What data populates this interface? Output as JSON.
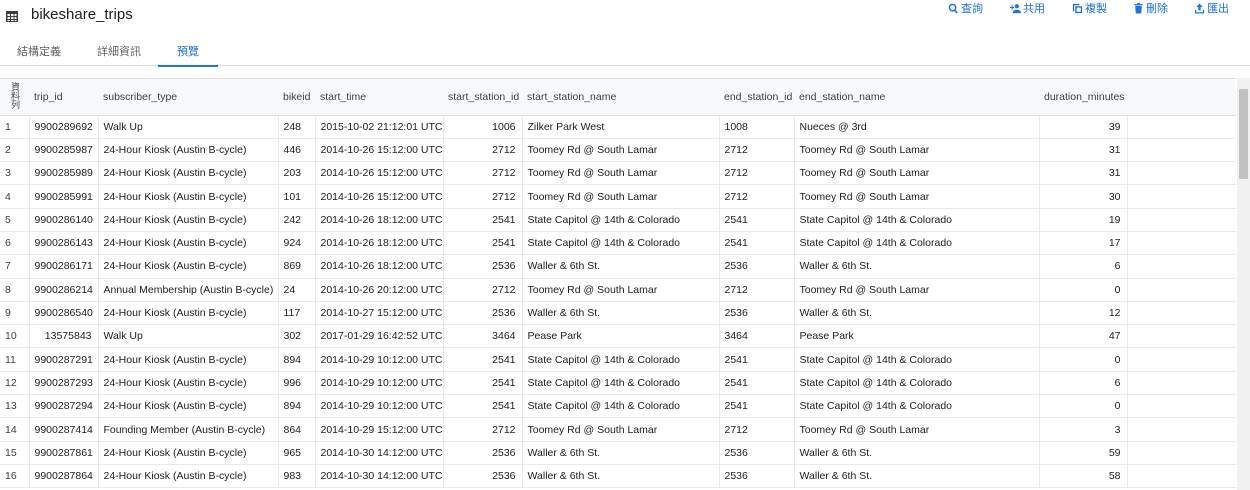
{
  "header": {
    "title": "bikeshare_trips",
    "actions": {
      "query": "查詢",
      "share": "共用",
      "copy": "複製",
      "delete": "刪除",
      "export": "匯出"
    }
  },
  "tabs": {
    "schema": "結構定義",
    "details": "詳細資訊",
    "preview": "預覽"
  },
  "table": {
    "row_header_label": "資料列",
    "columns": {
      "trip_id": "trip_id",
      "subscriber_type": "subscriber_type",
      "bikeid": "bikeid",
      "start_time": "start_time",
      "start_station_id": "start_station_id",
      "start_station_name": "start_station_name",
      "end_station_id": "end_station_id",
      "end_station_name": "end_station_name",
      "duration_minutes": "duration_minutes"
    },
    "rows": [
      {
        "n": "1",
        "trip_id": "9900289692",
        "subscriber_type": "Walk Up",
        "bikeid": "248",
        "start_time": "2015-10-02 21:12:01 UTC",
        "start_station_id": "1006",
        "start_station_name": "Zilker Park West",
        "end_station_id": "1008",
        "end_station_name": "Nueces @ 3rd",
        "duration_minutes": "39"
      },
      {
        "n": "2",
        "trip_id": "9900285987",
        "subscriber_type": "24-Hour Kiosk (Austin B-cycle)",
        "bikeid": "446",
        "start_time": "2014-10-26 15:12:00 UTC",
        "start_station_id": "2712",
        "start_station_name": "Toomey Rd @ South Lamar",
        "end_station_id": "2712",
        "end_station_name": "Toomey Rd @ South Lamar",
        "duration_minutes": "31"
      },
      {
        "n": "3",
        "trip_id": "9900285989",
        "subscriber_type": "24-Hour Kiosk (Austin B-cycle)",
        "bikeid": "203",
        "start_time": "2014-10-26 15:12:00 UTC",
        "start_station_id": "2712",
        "start_station_name": "Toomey Rd @ South Lamar",
        "end_station_id": "2712",
        "end_station_name": "Toomey Rd @ South Lamar",
        "duration_minutes": "31"
      },
      {
        "n": "4",
        "trip_id": "9900285991",
        "subscriber_type": "24-Hour Kiosk (Austin B-cycle)",
        "bikeid": "101",
        "start_time": "2014-10-26 15:12:00 UTC",
        "start_station_id": "2712",
        "start_station_name": "Toomey Rd @ South Lamar",
        "end_station_id": "2712",
        "end_station_name": "Toomey Rd @ South Lamar",
        "duration_minutes": "30"
      },
      {
        "n": "5",
        "trip_id": "9900286140",
        "subscriber_type": "24-Hour Kiosk (Austin B-cycle)",
        "bikeid": "242",
        "start_time": "2014-10-26 18:12:00 UTC",
        "start_station_id": "2541",
        "start_station_name": "State Capitol @ 14th & Colorado",
        "end_station_id": "2541",
        "end_station_name": "State Capitol @ 14th & Colorado",
        "duration_minutes": "19"
      },
      {
        "n": "6",
        "trip_id": "9900286143",
        "subscriber_type": "24-Hour Kiosk (Austin B-cycle)",
        "bikeid": "924",
        "start_time": "2014-10-26 18:12:00 UTC",
        "start_station_id": "2541",
        "start_station_name": "State Capitol @ 14th & Colorado",
        "end_station_id": "2541",
        "end_station_name": "State Capitol @ 14th & Colorado",
        "duration_minutes": "17"
      },
      {
        "n": "7",
        "trip_id": "9900286171",
        "subscriber_type": "24-Hour Kiosk (Austin B-cycle)",
        "bikeid": "869",
        "start_time": "2014-10-26 18:12:00 UTC",
        "start_station_id": "2536",
        "start_station_name": "Waller & 6th St.",
        "end_station_id": "2536",
        "end_station_name": "Waller & 6th St.",
        "duration_minutes": "6"
      },
      {
        "n": "8",
        "trip_id": "9900286214",
        "subscriber_type": "Annual Membership (Austin B-cycle)",
        "bikeid": "24",
        "start_time": "2014-10-26 20:12:00 UTC",
        "start_station_id": "2712",
        "start_station_name": "Toomey Rd @ South Lamar",
        "end_station_id": "2712",
        "end_station_name": "Toomey Rd @ South Lamar",
        "duration_minutes": "0"
      },
      {
        "n": "9",
        "trip_id": "9900286540",
        "subscriber_type": "24-Hour Kiosk (Austin B-cycle)",
        "bikeid": "117",
        "start_time": "2014-10-27 15:12:00 UTC",
        "start_station_id": "2536",
        "start_station_name": "Waller & 6th St.",
        "end_station_id": "2536",
        "end_station_name": "Waller & 6th St.",
        "duration_minutes": "12"
      },
      {
        "n": "10",
        "trip_id": "13575843",
        "subscriber_type": "Walk Up",
        "bikeid": "302",
        "start_time": "2017-01-29 16:42:52 UTC",
        "start_station_id": "3464",
        "start_station_name": "Pease Park",
        "end_station_id": "3464",
        "end_station_name": "Pease Park",
        "duration_minutes": "47"
      },
      {
        "n": "11",
        "trip_id": "9900287291",
        "subscriber_type": "24-Hour Kiosk (Austin B-cycle)",
        "bikeid": "894",
        "start_time": "2014-10-29 10:12:00 UTC",
        "start_station_id": "2541",
        "start_station_name": "State Capitol @ 14th & Colorado",
        "end_station_id": "2541",
        "end_station_name": "State Capitol @ 14th & Colorado",
        "duration_minutes": "0"
      },
      {
        "n": "12",
        "trip_id": "9900287293",
        "subscriber_type": "24-Hour Kiosk (Austin B-cycle)",
        "bikeid": "996",
        "start_time": "2014-10-29 10:12:00 UTC",
        "start_station_id": "2541",
        "start_station_name": "State Capitol @ 14th & Colorado",
        "end_station_id": "2541",
        "end_station_name": "State Capitol @ 14th & Colorado",
        "duration_minutes": "6"
      },
      {
        "n": "13",
        "trip_id": "9900287294",
        "subscriber_type": "24-Hour Kiosk (Austin B-cycle)",
        "bikeid": "894",
        "start_time": "2014-10-29 10:12:00 UTC",
        "start_station_id": "2541",
        "start_station_name": "State Capitol @ 14th & Colorado",
        "end_station_id": "2541",
        "end_station_name": "State Capitol @ 14th & Colorado",
        "duration_minutes": "0"
      },
      {
        "n": "14",
        "trip_id": "9900287414",
        "subscriber_type": "Founding Member (Austin B-cycle)",
        "bikeid": "864",
        "start_time": "2014-10-29 15:12:00 UTC",
        "start_station_id": "2712",
        "start_station_name": "Toomey Rd @ South Lamar",
        "end_station_id": "2712",
        "end_station_name": "Toomey Rd @ South Lamar",
        "duration_minutes": "3"
      },
      {
        "n": "15",
        "trip_id": "9900287861",
        "subscriber_type": "24-Hour Kiosk (Austin B-cycle)",
        "bikeid": "965",
        "start_time": "2014-10-30 14:12:00 UTC",
        "start_station_id": "2536",
        "start_station_name": "Waller & 6th St.",
        "end_station_id": "2536",
        "end_station_name": "Waller & 6th St.",
        "duration_minutes": "59"
      },
      {
        "n": "16",
        "trip_id": "9900287864",
        "subscriber_type": "24-Hour Kiosk (Austin B-cycle)",
        "bikeid": "983",
        "start_time": "2014-10-30 14:12:00 UTC",
        "start_station_id": "2536",
        "start_station_name": "Waller & 6th St.",
        "end_station_id": "2536",
        "end_station_name": "Waller & 6th St.",
        "duration_minutes": "58"
      }
    ]
  }
}
